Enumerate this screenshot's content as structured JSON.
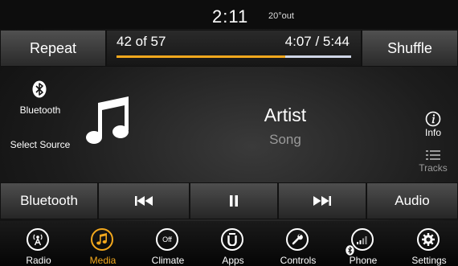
{
  "status": {
    "time": "2:11",
    "temperature": "20°out"
  },
  "top": {
    "repeat_label": "Repeat",
    "shuffle_label": "Shuffle",
    "track_position": "42 of 57",
    "time_position": "4:07 / 5:44",
    "progress_fraction": 0.72
  },
  "side_left": {
    "bluetooth_label": "Bluetooth",
    "select_source_label": "Select Source"
  },
  "now_playing": {
    "artist": "Artist",
    "song": "Song"
  },
  "side_right": {
    "info_label": "Info",
    "tracks_label": "Tracks"
  },
  "transport": {
    "source_label": "Bluetooth",
    "audio_label": "Audio"
  },
  "nav": {
    "items": [
      {
        "label": "Radio",
        "icon": "radio-icon"
      },
      {
        "label": "Media",
        "icon": "music-note-icon"
      },
      {
        "label": "Climate",
        "icon": "climate-off-icon"
      },
      {
        "label": "Apps",
        "icon": "apps-icon"
      },
      {
        "label": "Controls",
        "icon": "wrench-icon"
      },
      {
        "label": "Phone",
        "icon": "phone-signal-icon"
      },
      {
        "label": "Settings",
        "icon": "gear-icon"
      }
    ],
    "climate_badge": "Off",
    "active_index": 1
  },
  "colors": {
    "accent": "#f3a81d",
    "progress_track": "#cfd6e6"
  }
}
